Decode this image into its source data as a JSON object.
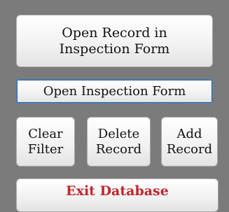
{
  "buttons": {
    "open_record_line1": "Open Record in",
    "open_record_line2": "Inspection Form",
    "open_inspection_form": "Open Inspection Form",
    "clear_filter_line1": "Clear",
    "clear_filter_line2": "Filter",
    "delete_record_line1": "Delete",
    "delete_record_line2": "Record",
    "add_record_line1": "Add",
    "add_record_line2": "Record",
    "exit_database": "Exit Database"
  },
  "colors": {
    "background": "#7b7b7b",
    "button_face": "#f1f1f1",
    "exit_text": "#c0262d",
    "focus_border": "#2a5b96"
  }
}
